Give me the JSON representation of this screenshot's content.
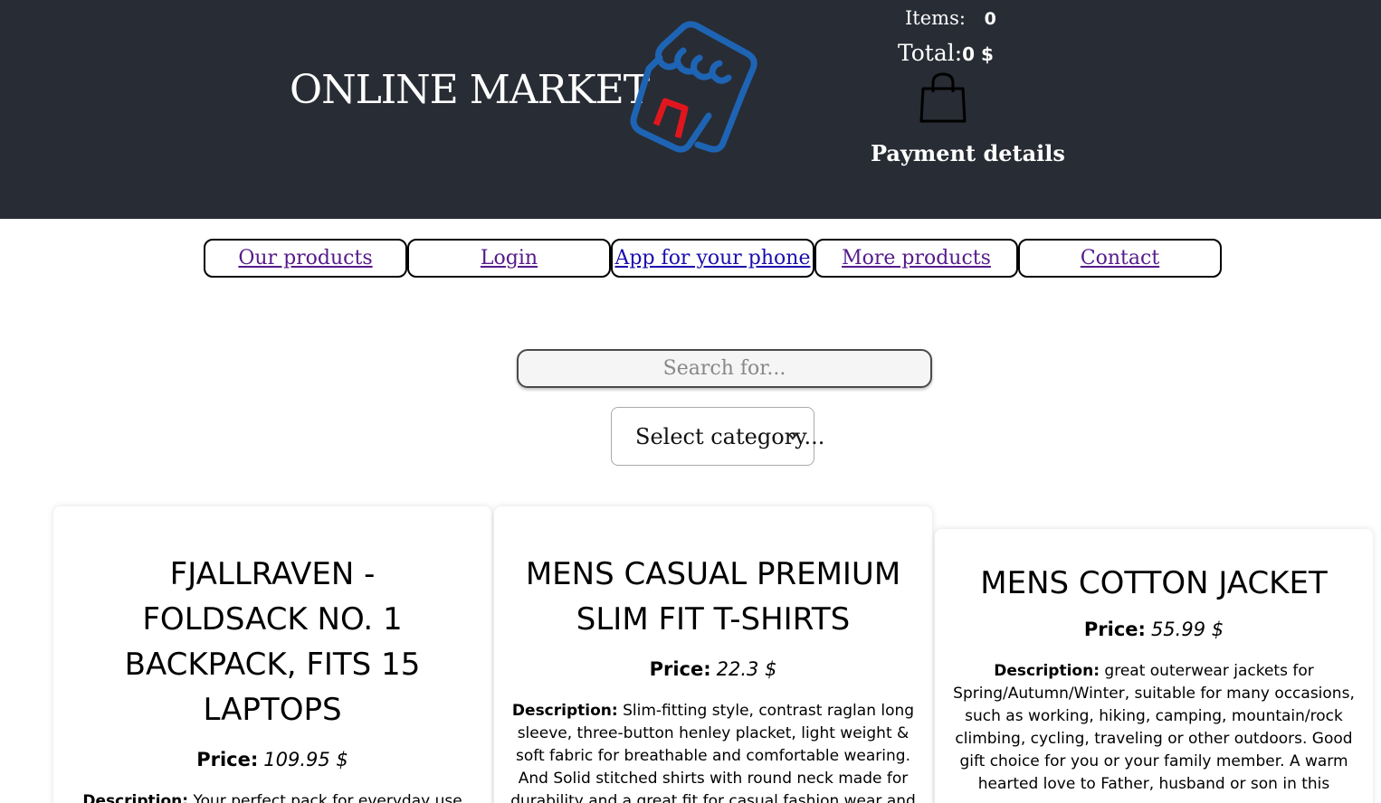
{
  "header": {
    "brand": "ONLINE MARKET",
    "cart": {
      "items_label": "Items:",
      "items_count": "0",
      "total_label": "Total:",
      "total_value": "0 $",
      "payment_label": "Payment details"
    }
  },
  "nav": [
    {
      "label": "Our products"
    },
    {
      "label": "Login"
    },
    {
      "label": "App for your phone"
    },
    {
      "label": "More products"
    },
    {
      "label": "Contact"
    }
  ],
  "search": {
    "placeholder": "Search for..."
  },
  "category": {
    "selected": "Select category..."
  },
  "products": [
    {
      "title": "FJALLRAVEN - FOLDSACK NO. 1 BACKPACK, FITS 15 LAPTOPS",
      "price_label": "Price:",
      "price": "109.95 $",
      "desc_label": "Description:",
      "desc": "Your perfect pack for everyday use and"
    },
    {
      "title": "MENS CASUAL PREMIUM SLIM FIT T-SHIRTS",
      "price_label": "Price:",
      "price": "22.3 $",
      "desc_label": "Description:",
      "desc": "Slim-fitting style, contrast raglan long sleeve, three-button henley placket, light weight & soft fabric for breathable and comfortable wearing. And Solid stitched shirts with round neck made for durability and a great fit for casual fashion wear and"
    },
    {
      "title": "MENS COTTON JACKET",
      "price_label": "Price:",
      "price": "55.99 $",
      "desc_label": "Description:",
      "desc": "great outerwear jackets for Spring/Autumn/Winter, suitable for many occasions, such as working, hiking, camping, mountain/rock climbing, cycling, traveling or other outdoors. Good gift choice for you or your family member. A warm hearted love to Father, husband or son in this"
    }
  ],
  "colors": {
    "header_bg": "#282c34",
    "logo_blue": "#1e64b4",
    "logo_red": "#e0161e",
    "link_purple": "#551a8b",
    "link_blue": "#1a0dab"
  }
}
